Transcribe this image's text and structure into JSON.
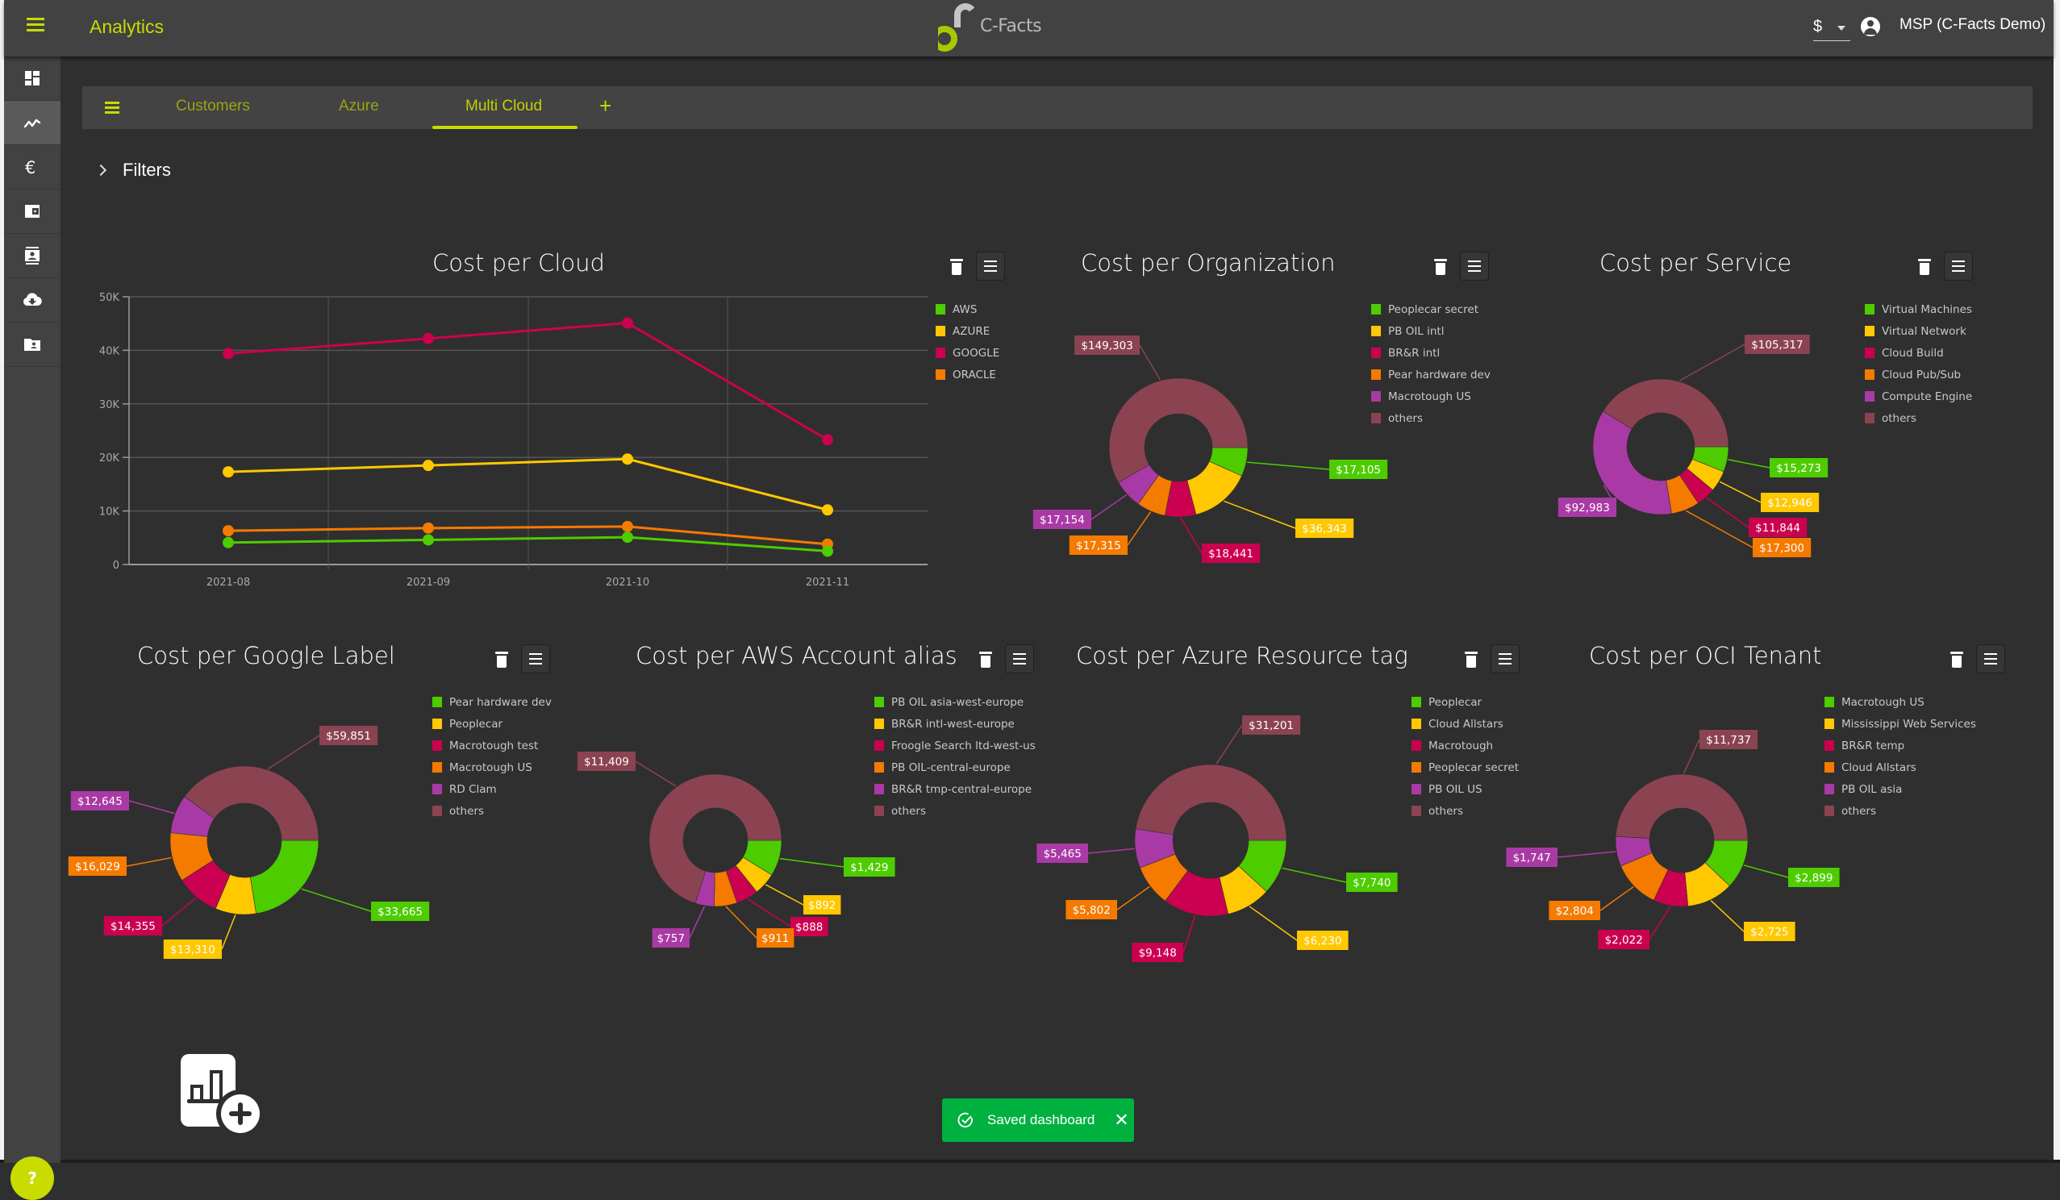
{
  "app": {
    "title": "Analytics",
    "logo_text": "C-Facts",
    "currency": "$",
    "user": "MSP (C-Facts Demo)"
  },
  "sidebar": {
    "items": [
      {
        "icon": "dashboard-icon",
        "active": false
      },
      {
        "icon": "trend-chart-icon",
        "active": true
      },
      {
        "icon": "euro-icon",
        "active": false
      },
      {
        "icon": "wallet-icon",
        "active": false
      },
      {
        "icon": "contact-card-icon",
        "active": false
      },
      {
        "icon": "cloud-download-icon",
        "active": false
      },
      {
        "icon": "shared-folder-icon",
        "active": false
      }
    ],
    "help_label": "?"
  },
  "tabs": {
    "items": [
      {
        "label": "Customers",
        "active": false
      },
      {
        "label": "Azure",
        "active": false
      },
      {
        "label": "Multi Cloud",
        "active": true
      }
    ],
    "add_label": "+"
  },
  "filters": {
    "label": "Filters"
  },
  "toast": {
    "message": "Saved dashboard",
    "close": "✕"
  },
  "colors": {
    "green": "#4dcc00",
    "yellow": "#ffc800",
    "crimson": "#cc0050",
    "orange": "#f57a00",
    "purple": "#a93aa5",
    "others": "#8b4352",
    "accent": "#c8dc00",
    "toast": "#00b140"
  },
  "chart_data": [
    {
      "type": "line",
      "title": "Cost per Cloud",
      "x": [
        "2021-08",
        "2021-09",
        "2021-10",
        "2021-11"
      ],
      "ylim": [
        0,
        50000
      ],
      "yticks": [
        "0",
        "10K",
        "20K",
        "30K",
        "40K",
        "50K"
      ],
      "ytick_values": [
        0,
        10000,
        20000,
        30000,
        40000,
        50000
      ],
      "grid": true,
      "legend_position": "right",
      "series": [
        {
          "name": "AWS",
          "color": "#4dcc00",
          "values": [
            4100,
            4600,
            5100,
            2500
          ]
        },
        {
          "name": "AZURE",
          "color": "#ffc800",
          "values": [
            17300,
            18500,
            19700,
            10200
          ]
        },
        {
          "name": "GOOGLE",
          "color": "#cc0050",
          "values": [
            39400,
            42200,
            45100,
            23300
          ]
        },
        {
          "name": "ORACLE",
          "color": "#f57a00",
          "values": [
            6300,
            6800,
            7100,
            3800
          ]
        }
      ]
    },
    {
      "type": "pie",
      "title": "Cost per Organization",
      "legend_position": "right",
      "labels": [
        "Peoplecar secret",
        "PB OIL intl",
        "BR&R intl",
        "Pear hardware dev",
        "Macrotough US",
        "others"
      ],
      "values": [
        17105,
        36343,
        18441,
        17315,
        17154,
        149303
      ],
      "value_labels": [
        "$17,105",
        "$36,343",
        "$18,441",
        "$17,315",
        "$17,154",
        "$149,303"
      ]
    },
    {
      "type": "pie",
      "title": "Cost per Service",
      "legend_position": "right",
      "labels": [
        "Virtual Machines",
        "Virtual Network",
        "Cloud Build",
        "Cloud Pub/Sub",
        "Compute Engine",
        "others"
      ],
      "values": [
        15273,
        12946,
        11844,
        17300,
        92983,
        105317
      ],
      "value_labels": [
        "$15,273",
        "$12,946",
        "$11,844",
        "$17,300",
        "$92,983",
        "$105,317"
      ]
    },
    {
      "type": "pie",
      "title": "Cost per Google Label",
      "legend_position": "right",
      "labels": [
        "Pear hardware dev",
        "Peoplecar",
        "Macrotough test",
        "Macrotough US",
        "RD Clam",
        "others"
      ],
      "values": [
        33665,
        13310,
        14355,
        16029,
        12645,
        59851
      ],
      "value_labels": [
        "$33,665",
        "$13,310",
        "$14,355",
        "$16,029",
        "$12,645",
        "$59,851"
      ]
    },
    {
      "type": "pie",
      "title": "Cost per AWS Account alias",
      "legend_position": "right",
      "labels": [
        "PB OIL asia-west-europe",
        "BR&R intl-west-europe",
        "Froogle Search ltd-west-us",
        "PB OIL-central-europe",
        "BR&R tmp-central-europe",
        "others"
      ],
      "values": [
        1429,
        892,
        888,
        911,
        757,
        11409
      ],
      "value_labels": [
        "$1,429",
        "$892",
        "$888",
        "$911",
        "$757",
        "$11,409"
      ]
    },
    {
      "type": "pie",
      "title": "Cost per Azure Resource tag",
      "legend_position": "right",
      "labels": [
        "Peoplecar",
        "Cloud Allstars",
        "Macrotough",
        "Peoplecar secret",
        "PB OIL US",
        "others"
      ],
      "values": [
        7740,
        6230,
        9148,
        5802,
        5465,
        31201
      ],
      "value_labels": [
        "$7,740",
        "$6,230",
        "$9,148",
        "$5,802",
        "$5,465",
        "$31,201"
      ]
    },
    {
      "type": "pie",
      "title": "Cost per OCI Tenant",
      "legend_position": "right",
      "labels": [
        "Macrotough US",
        "Mississippi Web Services",
        "BR&R temp",
        "Cloud Allstars",
        "PB OIL asia",
        "others"
      ],
      "values": [
        2899,
        2725,
        2022,
        2804,
        1747,
        11737
      ],
      "value_labels": [
        "$2,899",
        "$2,725",
        "$2,022",
        "$2,804",
        "$1,747",
        "$11,737"
      ]
    }
  ]
}
